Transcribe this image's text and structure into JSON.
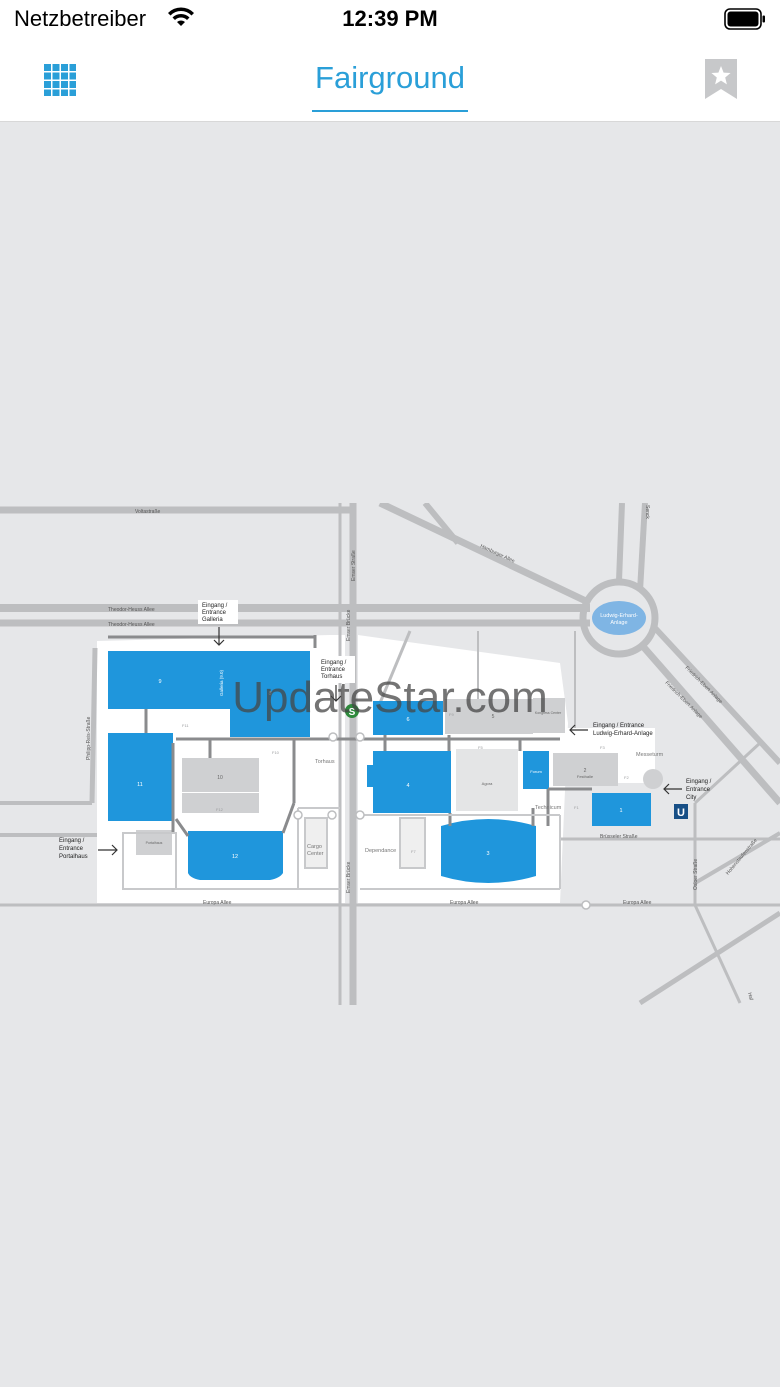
{
  "status_bar": {
    "carrier": "Netzbetreiber",
    "time": "12:39 PM"
  },
  "nav": {
    "title": "Fairground",
    "menu_icon": "grid-icon",
    "bookmark_icon": "bookmark-star-icon"
  },
  "colors": {
    "accent": "#2a9fd8",
    "hall": "#1f96dc",
    "road": "#bdbec0",
    "site": "#ffffff",
    "background": "#e6e7e9"
  },
  "map": {
    "streets": {
      "voltastrasse": "Voltastraße",
      "theodor1": "Theodor-Heuss Allee",
      "theodor2": "Theodor-Heuss Allee",
      "hamburger": "Hamburger Allee",
      "emser1": "Emser Straße",
      "emser2": "Emser Brücke",
      "emser3": "Emser Brücke",
      "philipp": "Philipp-Reis-Straße",
      "friedrich1": "Friedrich-Ebert-Anlage",
      "friedrich2": "Friedrich-Ebert-Anlage",
      "bruesseler": "Brüsseler Straße",
      "europa1": "Europa Allee",
      "europa2": "Europa Allee",
      "europa3": "Europa Allee",
      "osloer": "Osloer Straße",
      "hohenstaufen": "Hohenstaufenstraße",
      "senckenberg": "Senck",
      "hafen": "Haf"
    },
    "roundabout_label": [
      "Ludwig-Erhard-",
      "Anlage"
    ],
    "entrances": {
      "galleria": [
        "Eingang /",
        "Entrance",
        "Galleria"
      ],
      "torhaus": [
        "Eingang /",
        "Entrance",
        "Torhaus"
      ],
      "ludwig": [
        "Eingang / Entrance",
        "Ludwig-Erhard-Anlage"
      ],
      "city": [
        "Eingang /",
        "Entrance",
        "City"
      ],
      "portalhaus": [
        "Eingang /",
        "Entrance",
        "Portalhaus"
      ]
    },
    "halls": {
      "h9": "9",
      "galleria": "Galleria (9.0)",
      "h8": "8",
      "h11": "11",
      "h10": "10",
      "h12": "12",
      "h6": "6",
      "h5": "5",
      "h4": "4",
      "h3": "3",
      "h1": "1",
      "h2": "2",
      "h2_sub": "Festhalle",
      "forum": "Forum",
      "kongress": "Kongress Center",
      "agora": "Agora",
      "portalhaus": "Portalhaus"
    },
    "places": {
      "torhaus": "Torhaus",
      "cargo1": "Cargo",
      "cargo2": "Center",
      "dependance": "Dependance",
      "technicum": "Technicum",
      "messeturm": "Messeturm"
    },
    "areas": {
      "f11": "F11",
      "f10": "F10",
      "f12": "F12",
      "f1": "F1",
      "f2": "F2",
      "f3": "F3",
      "f5": "F5",
      "f7": "F7",
      "f9": "F9"
    },
    "badges": {
      "sbahn": "S",
      "ubahn": "U"
    }
  },
  "watermark": "UpdateStar.com"
}
